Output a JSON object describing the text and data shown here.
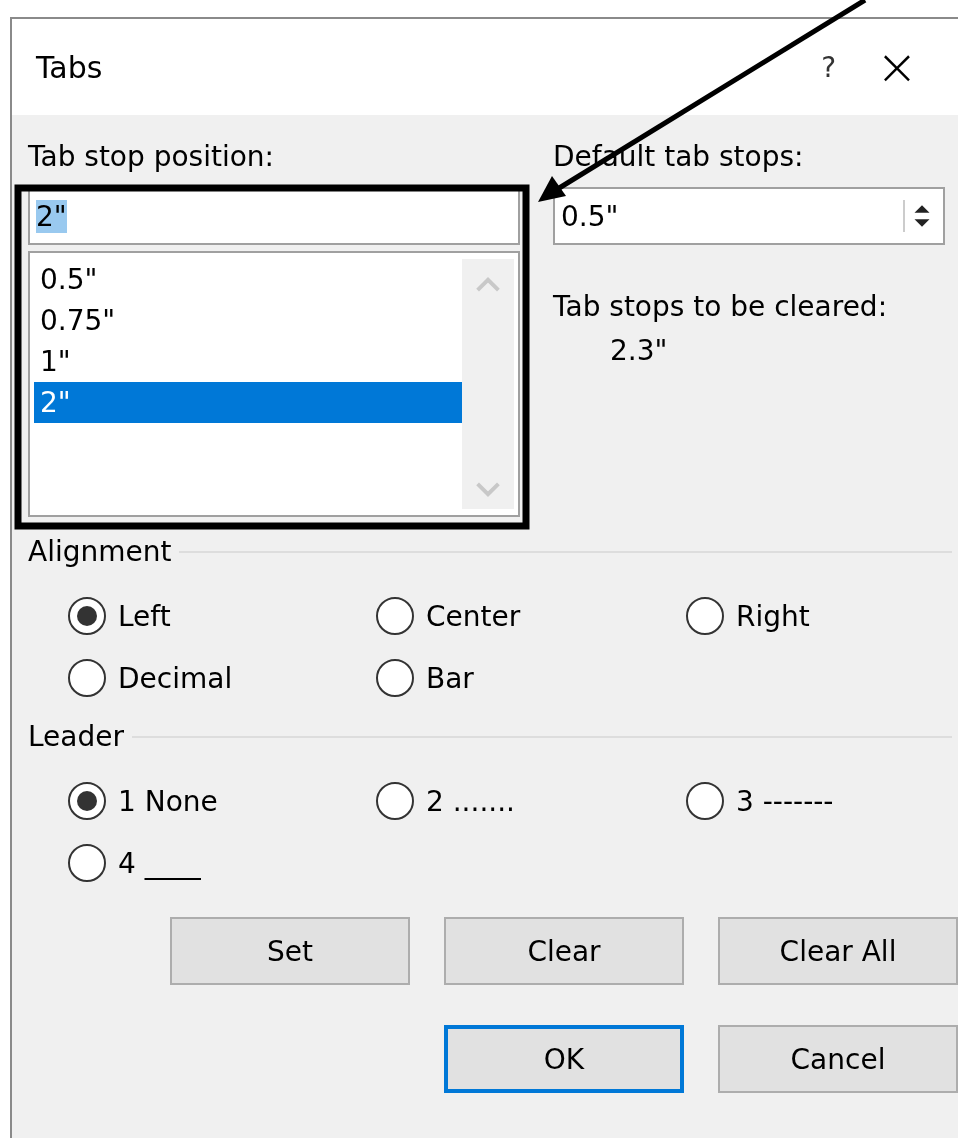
{
  "window": {
    "title": "Tabs",
    "help": "?",
    "close": "×"
  },
  "tab_stop_position": {
    "label": "Tab stop position:",
    "value": "2\"",
    "items": [
      {
        "label": "0.5\"",
        "selected": false
      },
      {
        "label": "0.75\"",
        "selected": false
      },
      {
        "label": "1\"",
        "selected": false
      },
      {
        "label": "2\"",
        "selected": true
      }
    ]
  },
  "default_tab_stops": {
    "label": "Default tab stops:",
    "value": "0.5\""
  },
  "tab_stops_to_be_cleared": {
    "label": "Tab stops to be cleared:",
    "value": "2.3\""
  },
  "alignment": {
    "label": "Alignment",
    "options": [
      {
        "label": "Left",
        "selected": true
      },
      {
        "label": "Center",
        "selected": false
      },
      {
        "label": "Right",
        "selected": false
      },
      {
        "label": "Decimal",
        "selected": false
      },
      {
        "label": "Bar",
        "selected": false
      }
    ]
  },
  "leader": {
    "label": "Leader",
    "options": [
      {
        "label": "1 None",
        "selected": true
      },
      {
        "label": "2 .......",
        "selected": false
      },
      {
        "label": "3 -------",
        "selected": false
      },
      {
        "label": "4 ____",
        "selected": false
      }
    ]
  },
  "buttons": [
    {
      "label": "Set",
      "default": false
    },
    {
      "label": "Clear",
      "default": false
    },
    {
      "label": "Clear All",
      "default": false
    }
  ],
  "footer_buttons": [
    {
      "label": "OK",
      "default": true
    },
    {
      "label": "Cancel",
      "default": false
    }
  ],
  "annotation": {
    "kind": "frame-arrow"
  }
}
